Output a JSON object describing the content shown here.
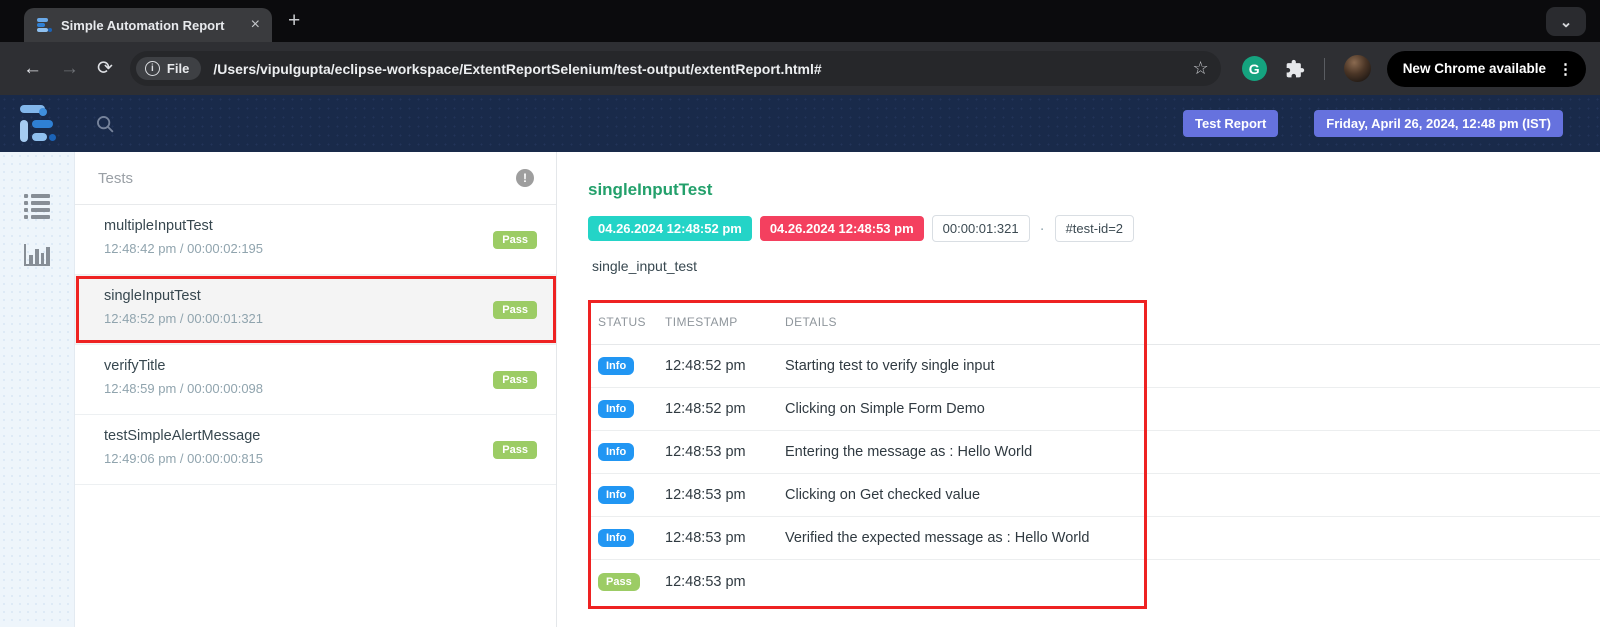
{
  "browser": {
    "tab_title": "Simple Automation Report",
    "url": "/Users/vipulgupta/eclipse-workspace/ExtentReportSelenium/test-output/extentReport.html#",
    "file_chip": "File",
    "update_button": "New Chrome available"
  },
  "icons": {
    "close_tab": "×",
    "new_tab": "+",
    "tab_search_chevron": "⌄",
    "back": "←",
    "forward": "→",
    "reload": "⟳",
    "site_info": "i",
    "bookmark_star": "☆",
    "grammarly": "G",
    "more_menu": "⋮",
    "tests_alert": "!"
  },
  "header": {
    "report_badge": "Test Report",
    "datetime_badge": "Friday, April 26, 2024, 12:48 pm (IST)"
  },
  "tests_panel": {
    "title": "Tests",
    "items": [
      {
        "name": "multipleInputTest",
        "meta": "12:48:42 pm / 00:00:02:195",
        "status": "Pass"
      },
      {
        "name": "singleInputTest",
        "meta": "12:48:52 pm / 00:00:01:321",
        "status": "Pass",
        "selected": true
      },
      {
        "name": "verifyTitle",
        "meta": "12:48:59 pm / 00:00:00:098",
        "status": "Pass"
      },
      {
        "name": "testSimpleAlertMessage",
        "meta": "12:49:06 pm / 00:00:00:815",
        "status": "Pass"
      }
    ]
  },
  "detail": {
    "title": "singleInputTest",
    "start_badge": "04.26.2024 12:48:52 pm",
    "end_badge": "04.26.2024 12:48:53 pm",
    "duration_badge": "00:00:01:321",
    "separator_dot": "·",
    "test_id_badge": "#test-id=2",
    "tag": "single_input_test",
    "log_table": {
      "headers": [
        "STATUS",
        "TIMESTAMP",
        "DETAILS"
      ],
      "rows": [
        {
          "status": "Info",
          "timestamp": "12:48:52 pm",
          "details": "Starting test to verify single input"
        },
        {
          "status": "Info",
          "timestamp": "12:48:52 pm",
          "details": "Clicking on Simple Form Demo"
        },
        {
          "status": "Info",
          "timestamp": "12:48:53 pm",
          "details": "Entering the message as : Hello World"
        },
        {
          "status": "Info",
          "timestamp": "12:48:53 pm",
          "details": "Clicking on Get checked value"
        },
        {
          "status": "Info",
          "timestamp": "12:48:53 pm",
          "details": "Verified the expected message as : Hello World"
        },
        {
          "status": "Pass",
          "timestamp": "12:48:53 pm",
          "details": ""
        }
      ]
    }
  },
  "colors": {
    "header_navy": "#192a4a",
    "badge_indigo": "#6672de",
    "title_green": "#23a06b",
    "start_teal": "#24d4c7",
    "end_red": "#f4405f",
    "info_blue": "#2196f3",
    "pass_green": "#9ccc65",
    "annotation_red": "#ee2222"
  }
}
